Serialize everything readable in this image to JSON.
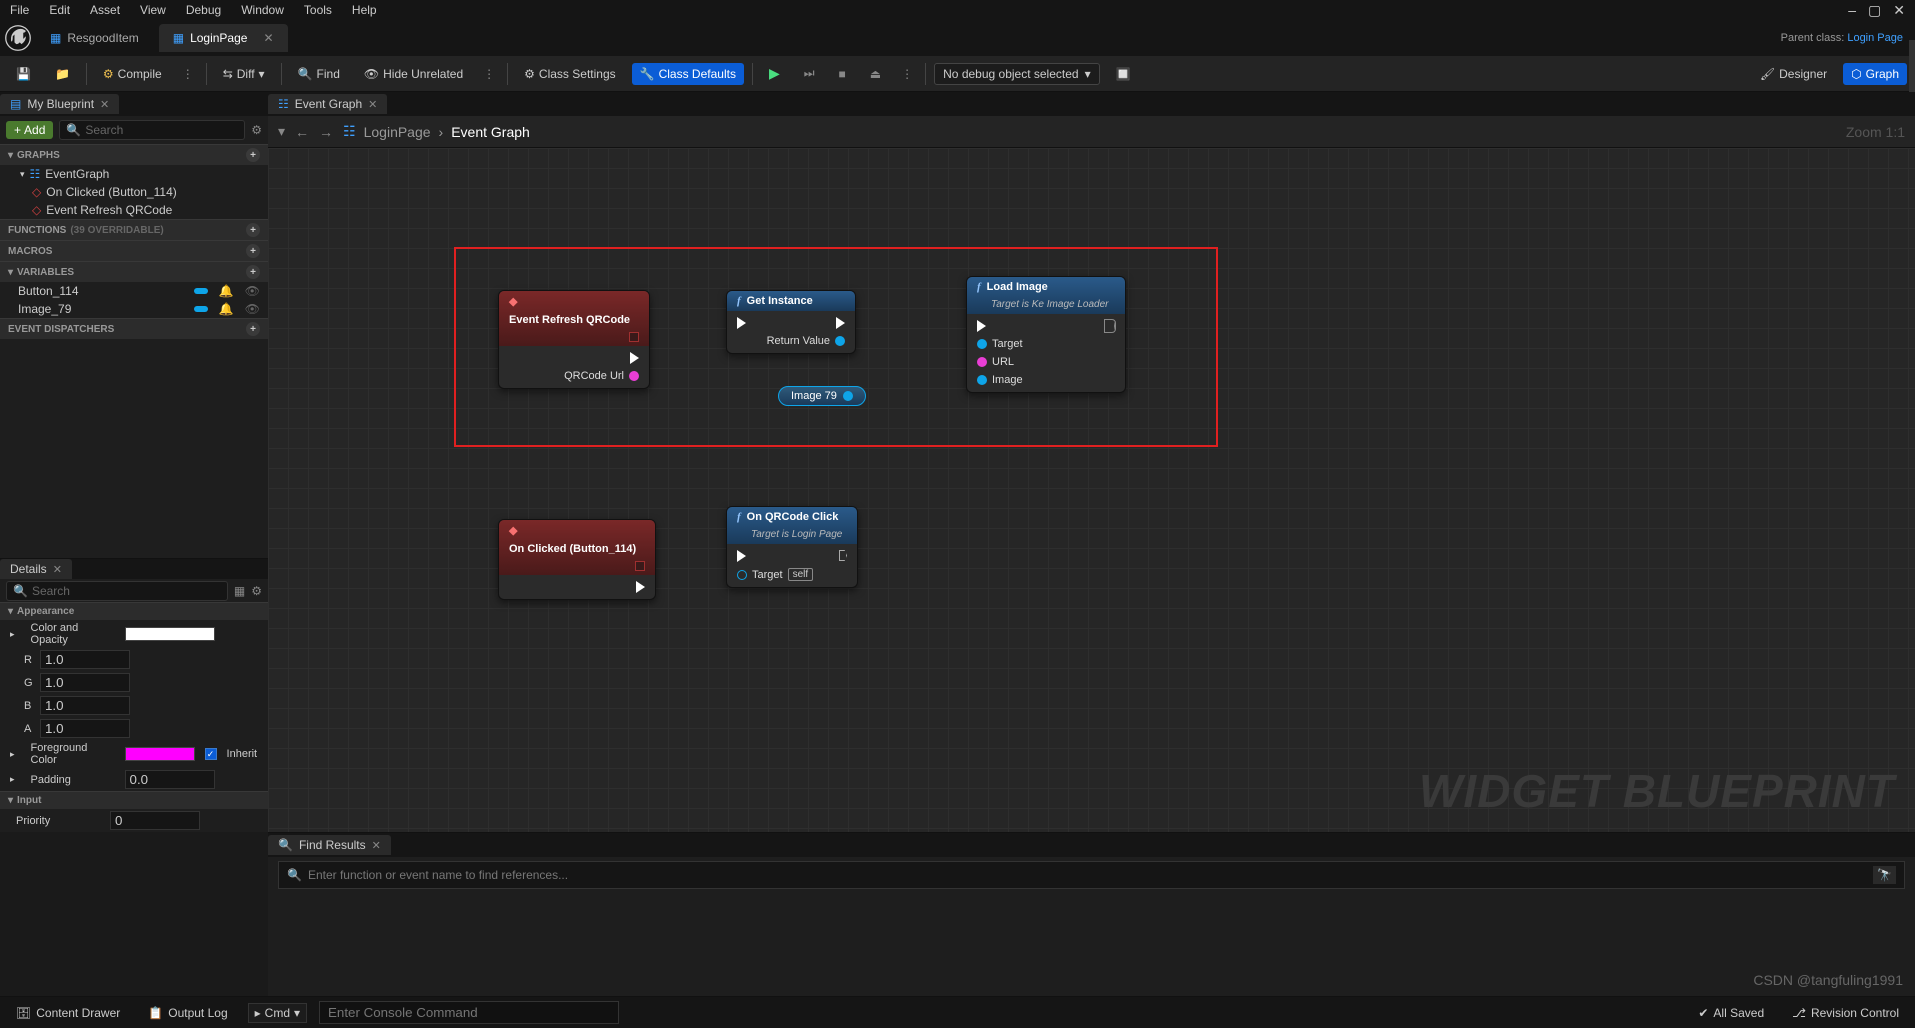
{
  "menubar": [
    "File",
    "Edit",
    "Asset",
    "View",
    "Debug",
    "Window",
    "Tools",
    "Help"
  ],
  "tabs": {
    "tab1": "ResgoodItem",
    "tab2": "LoginPage"
  },
  "parentClass": {
    "label": "Parent class:",
    "value": "Login Page"
  },
  "toolbar": {
    "compile": "Compile",
    "diff": "Diff",
    "find": "Find",
    "hideUnrelated": "Hide Unrelated",
    "classSettings": "Class Settings",
    "classDefaults": "Class Defaults",
    "debugDropdown": "No debug object selected",
    "designer": "Designer",
    "graph": "Graph"
  },
  "leftTabs": {
    "myBlueprint": "My Blueprint",
    "eventGraph": "Event Graph"
  },
  "search": {
    "placeholder": "Search"
  },
  "add": "Add",
  "sections": {
    "graphs": "GRAPHS",
    "functions": "FUNCTIONS",
    "functionsHint": "(39 OVERRIDABLE)",
    "macros": "MACROS",
    "variables": "VARIABLES",
    "eventDispatchers": "EVENT DISPATCHERS"
  },
  "tree": {
    "eventGraph": "EventGraph",
    "onClicked": "On Clicked (Button_114)",
    "eventRefresh": "Event Refresh QRCode"
  },
  "vars": {
    "button": "Button_114",
    "image": "Image_79"
  },
  "breadcrumb": {
    "root": "LoginPage",
    "current": "Event Graph"
  },
  "zoom": "Zoom 1:1",
  "watermark": "WIDGET BLUEPRINT",
  "csdn": "CSDN @tangfuling1991",
  "nodes": {
    "n1": {
      "title": "Event Refresh QRCode",
      "out1": "QRCode Url"
    },
    "n2": {
      "title": "Get Instance",
      "out1": "Return Value"
    },
    "n3": {
      "title": "Load Image",
      "subtitle": "Target is Ke Image Loader",
      "in1": "Target",
      "in2": "URL",
      "in3": "Image"
    },
    "varNode": "Image 79",
    "n4": {
      "title": "On Clicked (Button_114)"
    },
    "n5": {
      "title": "On QRCode Click",
      "subtitle": "Target is Login Page",
      "in1": "Target",
      "self": "self"
    }
  },
  "details": {
    "title": "Details",
    "search": "Search",
    "appearance": "Appearance",
    "colorOpacity": "Color and Opacity",
    "r": "R",
    "g": "G",
    "b": "B",
    "a": "A",
    "rval": "1.0",
    "gval": "1.0",
    "bval": "1.0",
    "aval": "1.0",
    "fgColor": "Foreground Color",
    "inherit": "Inherit",
    "padding": "Padding",
    "paddingVal": "0.0",
    "input": "Input",
    "priority": "Priority",
    "priorityVal": "0"
  },
  "find": {
    "title": "Find Results",
    "placeholder": "Enter function or event name to find references..."
  },
  "bottom": {
    "contentDrawer": "Content Drawer",
    "outputLog": "Output Log",
    "cmd": "Cmd",
    "consolePlaceholder": "Enter Console Command",
    "allSaved": "All Saved",
    "revisionControl": "Revision Control"
  }
}
